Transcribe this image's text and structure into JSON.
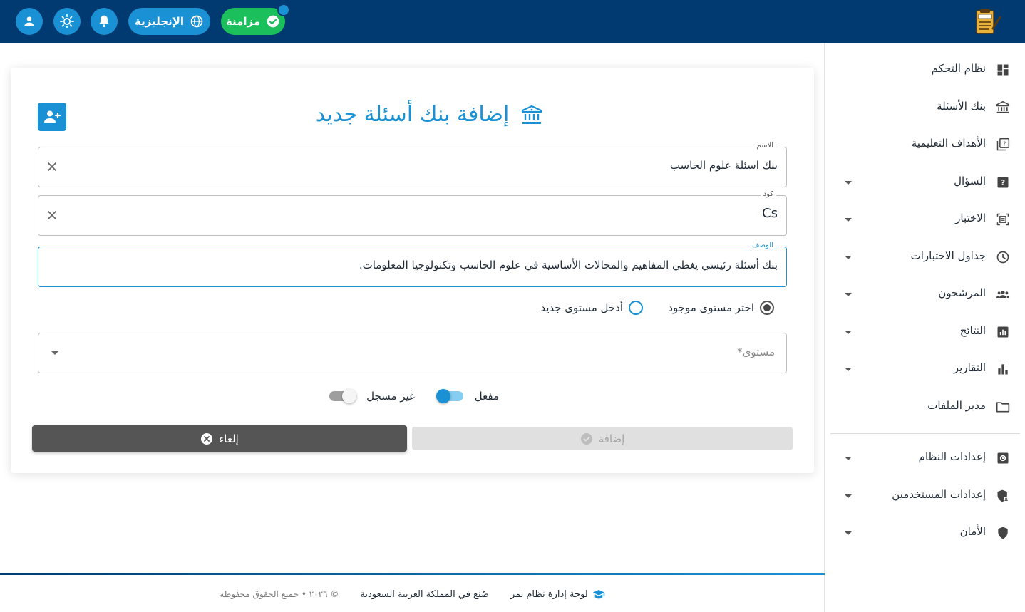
{
  "topbar": {
    "sync_label": "مزامنة",
    "language_label": "الإنجليزية",
    "icons": [
      "user-icon",
      "sun-icon",
      "bell-icon",
      "globe-icon",
      "check-circle-icon"
    ]
  },
  "sidebar": {
    "items": [
      {
        "label": "نظام التحكم",
        "icon": "dashboard-icon",
        "has_caret": false
      },
      {
        "label": "بنك الأسئلة",
        "icon": "bank-icon",
        "has_caret": false
      },
      {
        "label": "الأهداف التعليمية",
        "icon": "quiz-icon",
        "has_caret": false
      },
      {
        "label": "السؤال",
        "icon": "question-icon",
        "has_caret": true
      },
      {
        "label": "الاختبار",
        "icon": "exam-icon",
        "has_caret": true
      },
      {
        "label": "جداول الاختبارات",
        "icon": "clock-icon",
        "has_caret": true
      },
      {
        "label": "المرشحون",
        "icon": "group-icon",
        "has_caret": true
      },
      {
        "label": "النتائج",
        "icon": "results-icon",
        "has_caret": true
      },
      {
        "label": "التقارير",
        "icon": "bar-chart-icon",
        "has_caret": true
      },
      {
        "label": "مدير الملفات",
        "icon": "folder-icon",
        "has_caret": false
      },
      {
        "label": "إعدادات النظام",
        "icon": "settings-icon",
        "has_caret": true
      },
      {
        "label": "إعدادات المستخدمين",
        "icon": "user-shield-icon",
        "has_caret": true
      },
      {
        "label": "الأمان",
        "icon": "shield-icon",
        "has_caret": true
      }
    ]
  },
  "form": {
    "title": "إضافة بنك أسئلة جديد",
    "name": {
      "label": "الاسم",
      "value": "بنك اسئلة علوم الحاسب"
    },
    "code": {
      "label": "كود",
      "value": "Cs"
    },
    "description": {
      "label": "الوصف",
      "value": "بنك أسئلة رئيسي يغطي المفاهيم والمجالات الأساسية في علوم الحاسب وتكنولوجيا المعلومات."
    },
    "level_mode": {
      "existing_label": "اختر مستوى موجود",
      "new_label": "أدخل مستوى جديد",
      "selected": "existing"
    },
    "level": {
      "placeholder": "مستوى*"
    },
    "status": {
      "active_label": "مفعل",
      "unregistered_label": "غير مسجل"
    },
    "buttons": {
      "cancel_label": "إلغاء",
      "submit_label": "إضافة"
    }
  },
  "footer": {
    "brand": "لوحة إدارة نظام نمر",
    "made_in": "صُنع في المملكة العربية السعودية",
    "copyright": "© ٢٠٢٦ • جميع الحقوق محفوظة"
  },
  "colors": {
    "topbar": "#003a70",
    "accent": "#1a91d4",
    "success": "#1bbf5c",
    "cancel": "#555555"
  }
}
